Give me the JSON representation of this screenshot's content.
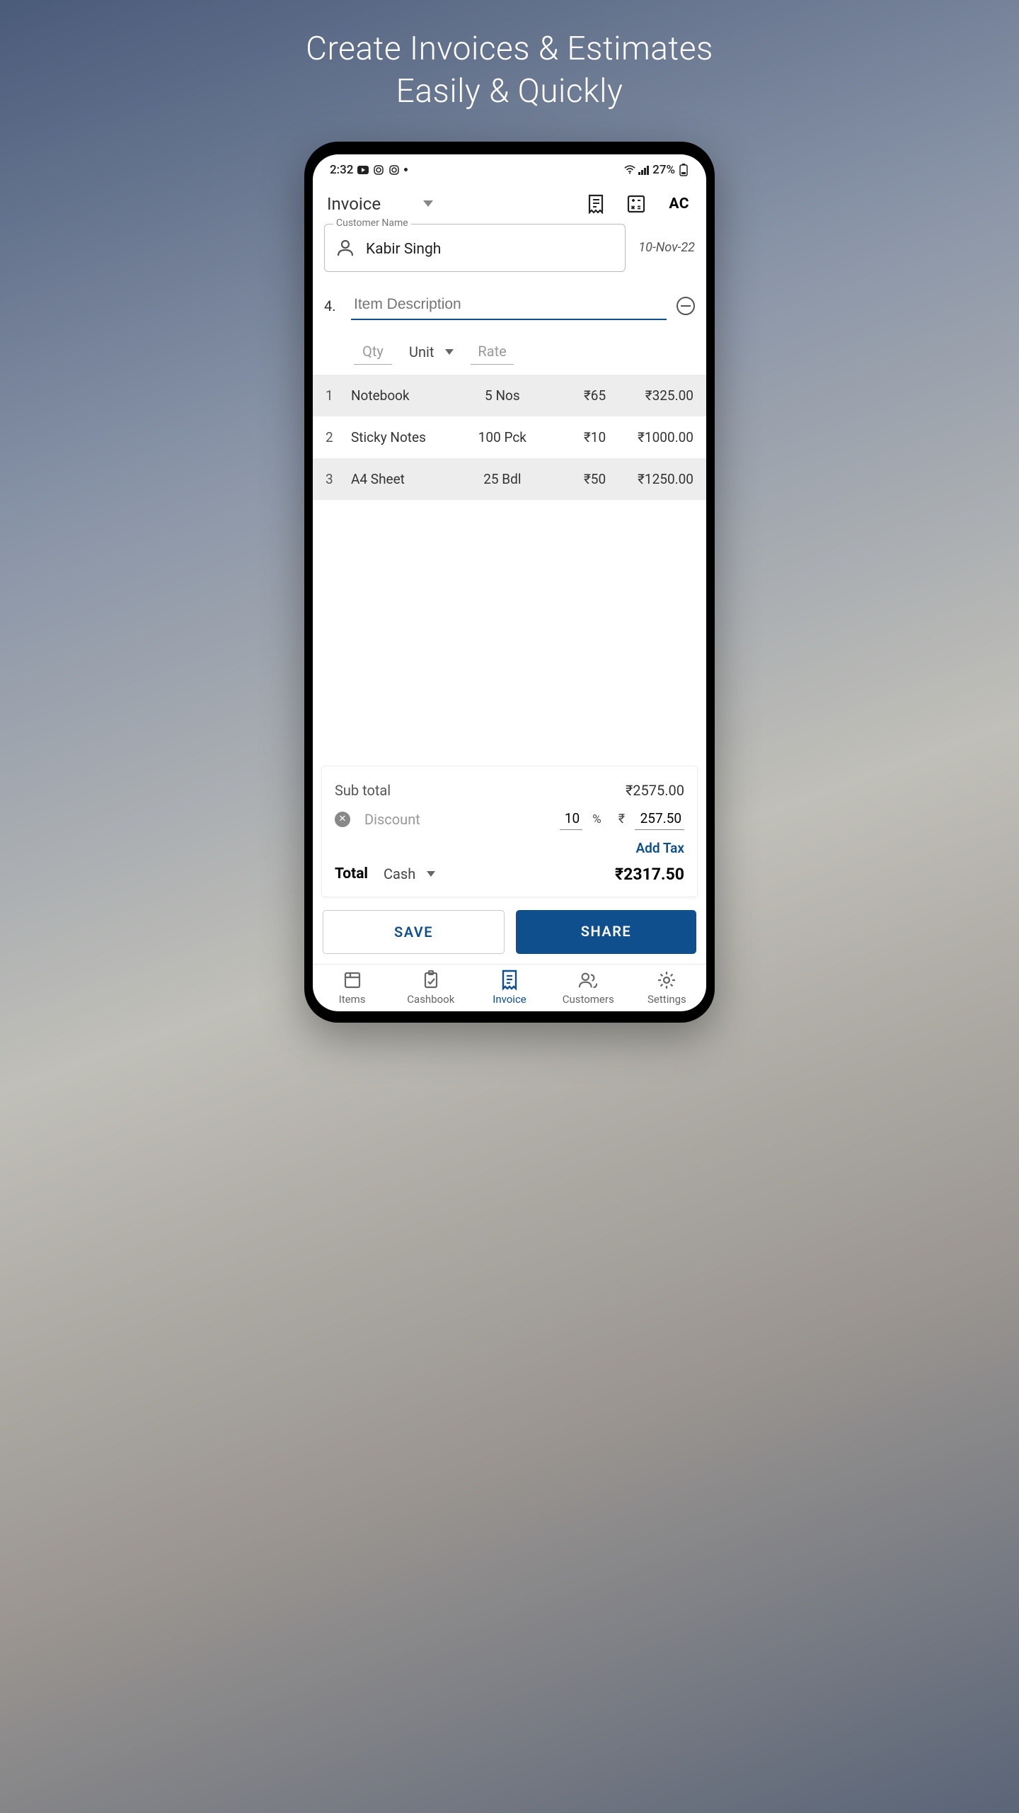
{
  "hero": {
    "line1": "Create Invoices & Estimates",
    "line2": "Easily & Quickly"
  },
  "status": {
    "time": "2:32",
    "battery": "27%"
  },
  "header": {
    "title": "Invoice",
    "ac": "AC"
  },
  "customer": {
    "label": "Customer Name",
    "name": "Kabir Singh",
    "date": "10-Nov-22"
  },
  "entry": {
    "num": "4.",
    "placeholder": "Item Description",
    "qty_placeholder": "Qty",
    "unit_label": "Unit",
    "rate_placeholder": "Rate"
  },
  "items": [
    {
      "idx": "1",
      "name": "Notebook",
      "qty": "5 Nos",
      "rate": "₹65",
      "total": "₹325.00"
    },
    {
      "idx": "2",
      "name": "Sticky Notes",
      "qty": "100 Pck",
      "rate": "₹10",
      "total": "₹1000.00"
    },
    {
      "idx": "3",
      "name": "A4 Sheet",
      "qty": "25 Bdl",
      "rate": "₹50",
      "total": "₹1250.00"
    }
  ],
  "totals": {
    "subtotal_label": "Sub total",
    "subtotal": "₹2575.00",
    "discount_label": "Discount",
    "discount_pct": "10",
    "pct_sign": "%",
    "rupee_sign": "₹",
    "discount_amt": "257.50",
    "add_tax": "Add Tax",
    "total_label": "Total",
    "payment": "Cash",
    "grand_total": "₹2317.50"
  },
  "actions": {
    "save": "SAVE",
    "share": "SHARE"
  },
  "nav": {
    "items_label": "Items",
    "cashbook_label": "Cashbook",
    "invoice_label": "Invoice",
    "customers_label": "Customers",
    "settings_label": "Settings"
  }
}
